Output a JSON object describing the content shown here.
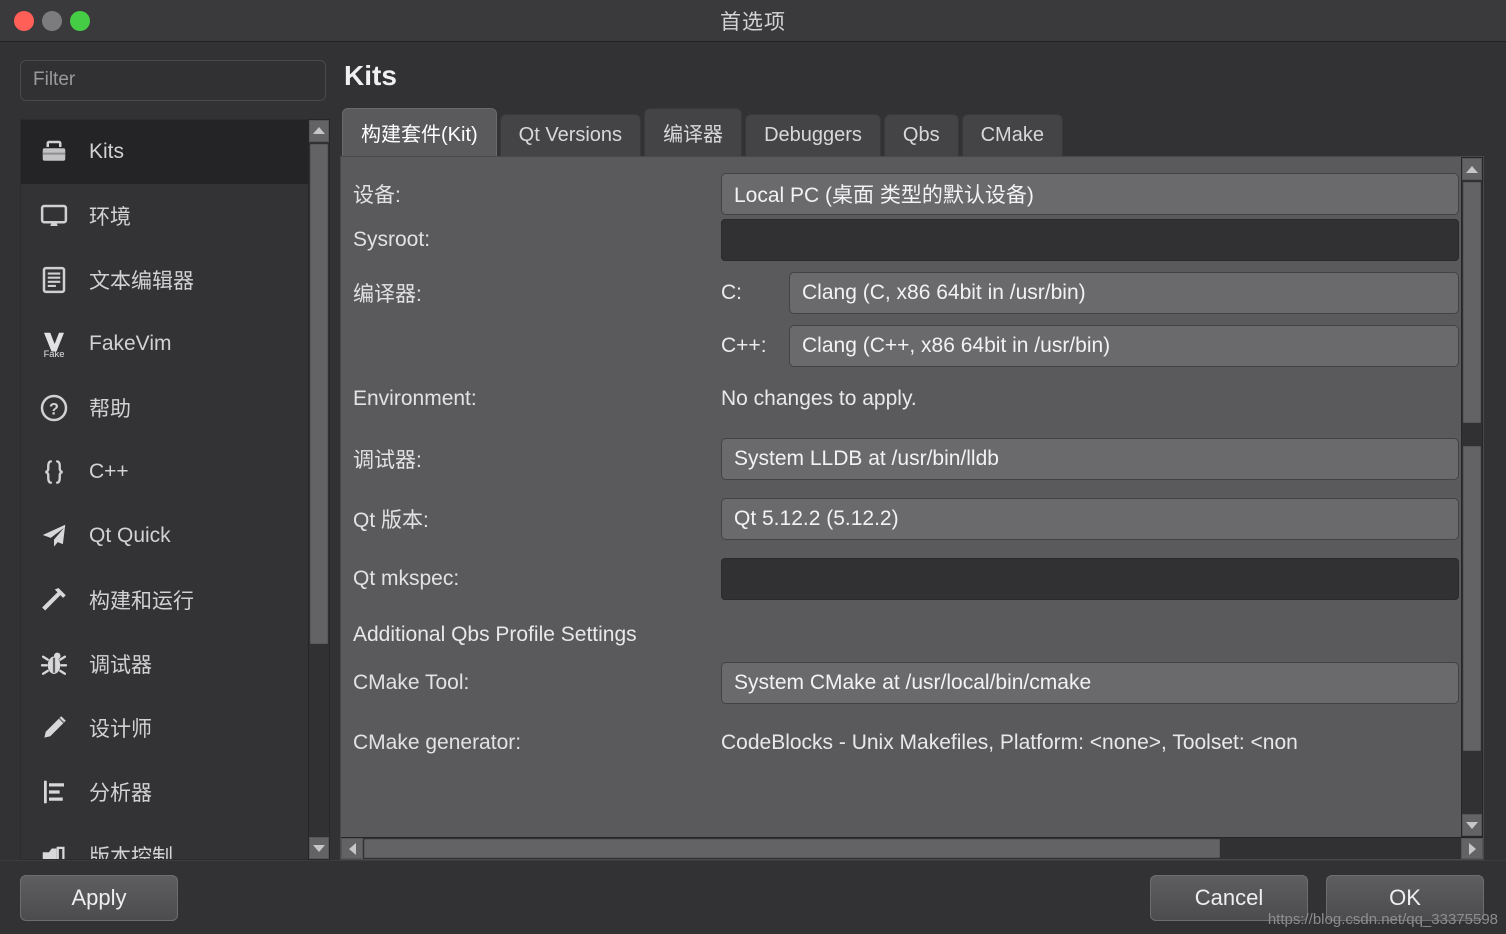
{
  "window": {
    "title": "首选项",
    "traffic_lights": [
      "close",
      "minimize",
      "zoom"
    ]
  },
  "search": {
    "placeholder": "Filter",
    "value": ""
  },
  "sidebar": {
    "items": [
      {
        "label": "Kits",
        "icon": "toolbox-icon",
        "selected": true
      },
      {
        "label": "环境",
        "icon": "monitor-icon",
        "selected": false
      },
      {
        "label": "文本编辑器",
        "icon": "document-icon",
        "selected": false
      },
      {
        "label": "FakeVim",
        "icon": "fakevim-icon",
        "selected": false
      },
      {
        "label": "帮助",
        "icon": "question-circle-icon",
        "selected": false
      },
      {
        "label": "C++",
        "icon": "braces-icon",
        "selected": false
      },
      {
        "label": "Qt Quick",
        "icon": "paper-plane-icon",
        "selected": false
      },
      {
        "label": "构建和运行",
        "icon": "hammer-icon",
        "selected": false
      },
      {
        "label": "调试器",
        "icon": "bug-icon",
        "selected": false
      },
      {
        "label": "设计师",
        "icon": "pencil-icon",
        "selected": false
      },
      {
        "label": "分析器",
        "icon": "analyzer-icon",
        "selected": false
      },
      {
        "label": "版本控制",
        "icon": "branch-icon",
        "selected": false
      }
    ]
  },
  "main": {
    "page_title": "Kits",
    "tabs": [
      {
        "label": "构建套件(Kit)",
        "active": true
      },
      {
        "label": "Qt Versions",
        "active": false
      },
      {
        "label": "编译器",
        "active": false
      },
      {
        "label": "Debuggers",
        "active": false
      },
      {
        "label": "Qbs",
        "active": false
      },
      {
        "label": "CMake",
        "active": false
      }
    ],
    "form": {
      "device_label": "设备:",
      "device_value": "Local PC (桌面 类型的默认设备)",
      "sysroot_label": "Sysroot:",
      "sysroot_value": "",
      "compiler_label": "编译器:",
      "compiler_c_label": "C:",
      "compiler_c_value": "Clang (C, x86 64bit in /usr/bin)",
      "compiler_cpp_label": "C++:",
      "compiler_cpp_value": "Clang (C++, x86 64bit in /usr/bin)",
      "environment_label": "Environment:",
      "environment_value": "No changes to apply.",
      "debugger_label": "调试器:",
      "debugger_value": "System LLDB at /usr/bin/lldb",
      "qtversion_label": "Qt 版本:",
      "qtversion_value": "Qt 5.12.2 (5.12.2)",
      "mkspec_label": "Qt mkspec:",
      "mkspec_value": "",
      "qbs_section": "Additional Qbs Profile Settings",
      "cmake_tool_label": "CMake Tool:",
      "cmake_tool_value": "System CMake at /usr/local/bin/cmake",
      "cmake_gen_label": "CMake generator:",
      "cmake_gen_value": "CodeBlocks - Unix Makefiles, Platform: <none>, Toolset: <non"
    }
  },
  "footer": {
    "apply_label": "Apply",
    "cancel_label": "Cancel",
    "ok_label": "OK",
    "watermark": "https://blog.csdn.net/qq_33375598"
  }
}
